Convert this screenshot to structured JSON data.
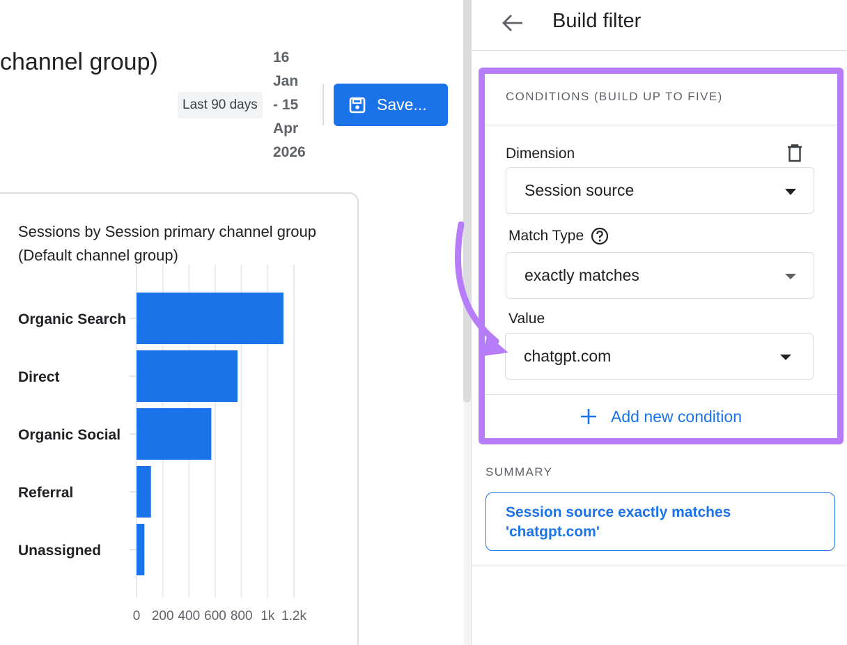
{
  "report": {
    "title": "channel group)",
    "date_chip": "Last 90 days",
    "date_range_lines": [
      "16",
      "Jan",
      "- 15",
      "Apr",
      "2026"
    ],
    "save_label": "Save..."
  },
  "card": {
    "title": "Sessions by Session primary channel group (Default channel group)"
  },
  "chart_data": {
    "type": "bar",
    "orientation": "horizontal",
    "title": "Sessions by Session primary channel group (Default channel group)",
    "categories": [
      "Organic Search",
      "Direct",
      "Organic Social",
      "Referral",
      "Unassigned"
    ],
    "values": [
      1120,
      770,
      570,
      110,
      60
    ],
    "xlim": [
      0,
      1300
    ],
    "x_ticks": [
      0,
      200,
      400,
      600,
      800,
      1000,
      1200
    ],
    "x_tick_labels": [
      "0",
      "200",
      "400",
      "600",
      "800",
      "1k",
      "1.2k"
    ],
    "grid": true,
    "color": "#1a73e8"
  },
  "panel": {
    "title": "Build filter",
    "back_icon": "arrow-back-icon",
    "conditions_heading": "CONDITIONS (BUILD UP TO FIVE)",
    "dimension_label": "Dimension",
    "dimension_value": "Session source",
    "match_type_label": "Match Type",
    "match_type_value": "exactly matches",
    "value_label": "Value",
    "value_value": "chatgpt.com",
    "add_condition_label": "Add new condition",
    "summary_heading": "SUMMARY",
    "summary_text": "Session source exactly matches 'chatgpt.com'"
  },
  "colors": {
    "accent": "#1a73e8",
    "highlight": "#b67cf9"
  }
}
